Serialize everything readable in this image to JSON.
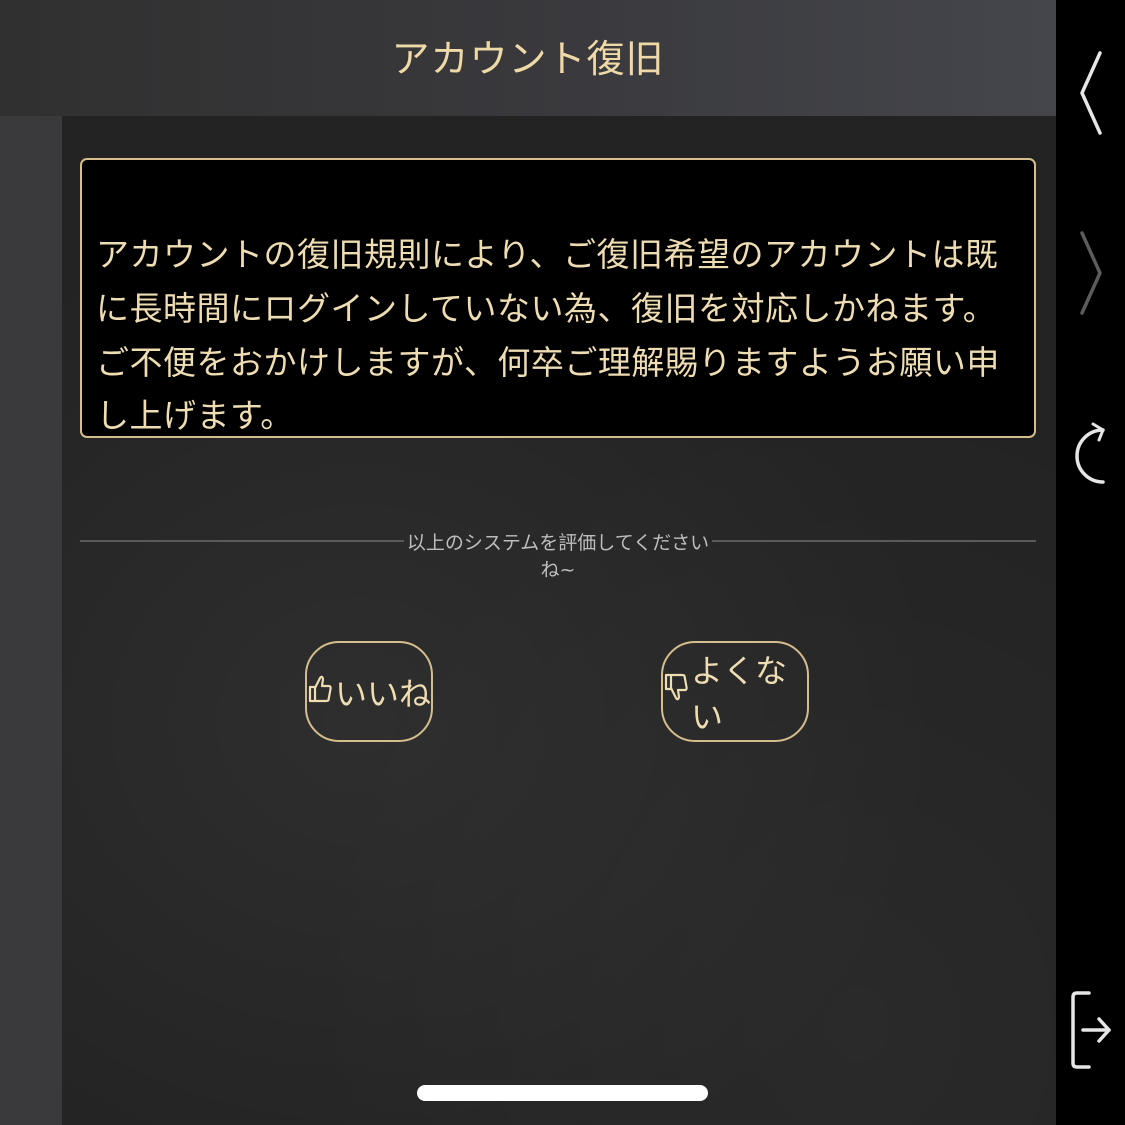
{
  "header": {
    "title": "アカウント復旧"
  },
  "message": {
    "text": "アカウントの復旧規則により、ご復旧希望のアカウントは既に長時間にログインしていない為、復旧を対応しかねます。ご不便をおかけしますが、何卒ご理解賜りますようお願い申し上げます。"
  },
  "rating": {
    "prompt": "以上のシステムを評価してくださいね~",
    "like_label": "いいね",
    "dislike_label": "よくない"
  },
  "side_bar": {
    "icons": [
      "back-icon",
      "forward-icon",
      "reload-icon",
      "exit-icon"
    ]
  },
  "colors": {
    "accent": "#d6bd8c",
    "text": "#eedcb2",
    "box_background": "#000000",
    "page_background": "#232323"
  }
}
